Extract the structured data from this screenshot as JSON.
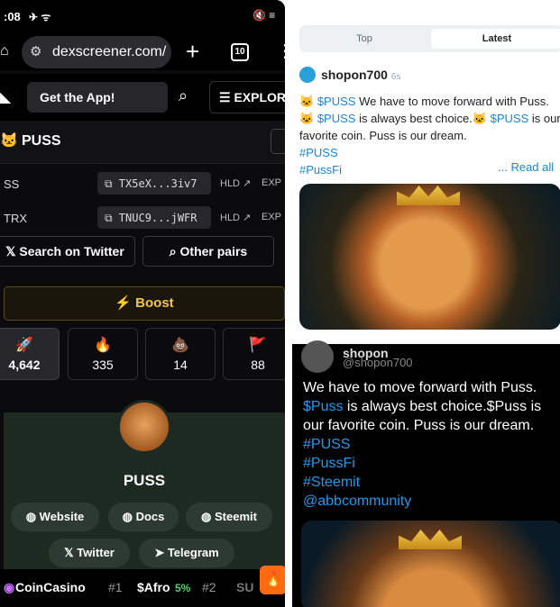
{
  "phone": {
    "status": {
      "time": ":08",
      "icons_left": "✈ ᯤ",
      "icons_right": "🔇 ≡"
    },
    "browser": {
      "url": "dexscreener.com/",
      "tab_count": "10"
    },
    "dex": {
      "get_app": "Get the App!",
      "explore": "EXPLORE",
      "token": {
        "name": "PUSS"
      },
      "pairs": [
        {
          "symbol": "SS",
          "address": "TX5eX...3iv7",
          "hld": "HLD",
          "exp": "EXP"
        },
        {
          "symbol": "TRX",
          "address": "TNUC9...jWFR",
          "hld": "HLD",
          "exp": "EXP"
        }
      ],
      "search_twitter": "Search on Twitter",
      "other_pairs": "Other pairs",
      "boost": "Boost",
      "stats": [
        {
          "icon": "🚀",
          "value": "4,642"
        },
        {
          "icon": "🔥",
          "value": "335"
        },
        {
          "icon": "💩",
          "value": "14"
        },
        {
          "icon": "🚩",
          "value": "88"
        }
      ],
      "hero_title": "PUSS",
      "links": {
        "website": "Website",
        "docs": "Docs",
        "steemit": "Steemit",
        "twitter": "Twitter",
        "telegram": "Telegram"
      },
      "ticker": {
        "brand": "CoinCasino",
        "item1_rank": "#1",
        "item1_name": "$Afro",
        "item1_change": "5%",
        "item2_rank": "#2",
        "item2_name": "SU"
      }
    }
  },
  "feed": {
    "tabs": {
      "top": "Top",
      "latest": "Latest"
    },
    "post": {
      "user": "shopon700",
      "ago": "6s",
      "line1_tag": "$PUSS",
      "line1_text": " We have to move forward with Puss.",
      "line2_tag": "$PUSS",
      "line2_text": " is always best choice.",
      "line2_tag2": "$PUSS",
      "line2_tail": " is our favorite coin. Puss is our dream.",
      "hashtag1": "#PUSS",
      "hashtag2": "#PussFi",
      "read_all": "... Read all"
    },
    "tweet": {
      "user": "shopon",
      "handle": "@shopon700",
      "line1": "We have to move forward with Puss.",
      "line2_tag": "$Puss",
      "line2_text": " is always best choice.$Puss is our favorite coin. Puss is our dream.",
      "tags": [
        "#PUSS",
        "#PussFi",
        "#Steemit",
        "@abbcommunity"
      ]
    }
  }
}
